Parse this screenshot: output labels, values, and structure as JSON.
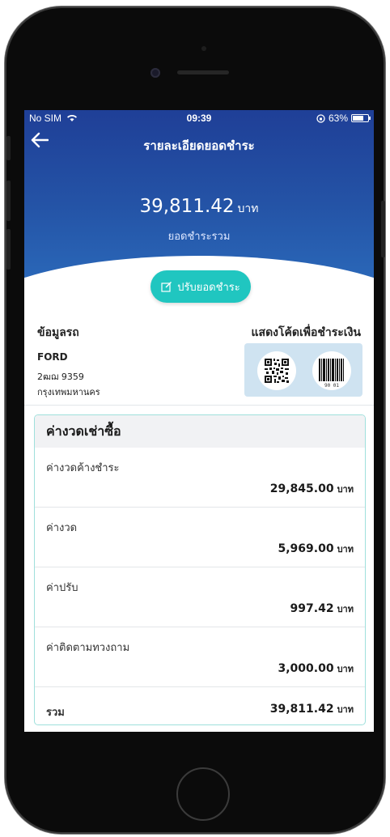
{
  "status_bar": {
    "carrier": "No SIM",
    "time": "09:39",
    "battery": "63%"
  },
  "header": {
    "back_icon": "←",
    "title": "รายละเอียดยอดชำระ"
  },
  "summary": {
    "amount": "39,811.42",
    "unit": "บาท",
    "label": "ยอดชำระรวม"
  },
  "adjust_button": {
    "label": "ปรับยอดชำระ"
  },
  "car_info": {
    "heading": "ข้อมูลรถ",
    "brand": "FORD",
    "plate": "2ฒฌ 9359",
    "province": "กรุงเทพมหานคร"
  },
  "payment_code": {
    "heading": "แสดงโค้ดเพื่อชำระเงิน",
    "barcode_digits": "90 01"
  },
  "installment_card": {
    "title": "ค่างวดเช่าซื้อ",
    "rows": [
      {
        "label": "ค่างวดค้างชำระ",
        "value": "29,845.00",
        "unit": "บาท"
      },
      {
        "label": "ค่างวด",
        "value": "5,969.00",
        "unit": "บาท"
      },
      {
        "label": "ค่าปรับ",
        "value": "997.42",
        "unit": "บาท"
      },
      {
        "label": "ค่าติดตามทวงถาม",
        "value": "3,000.00",
        "unit": "บาท"
      }
    ],
    "total": {
      "label": "รวม",
      "value": "39,811.42",
      "unit": "บาท"
    }
  },
  "colors": {
    "header_blue": "#2453a6",
    "accent_teal": "#20c6c0",
    "card_border": "#9fe0dc"
  }
}
